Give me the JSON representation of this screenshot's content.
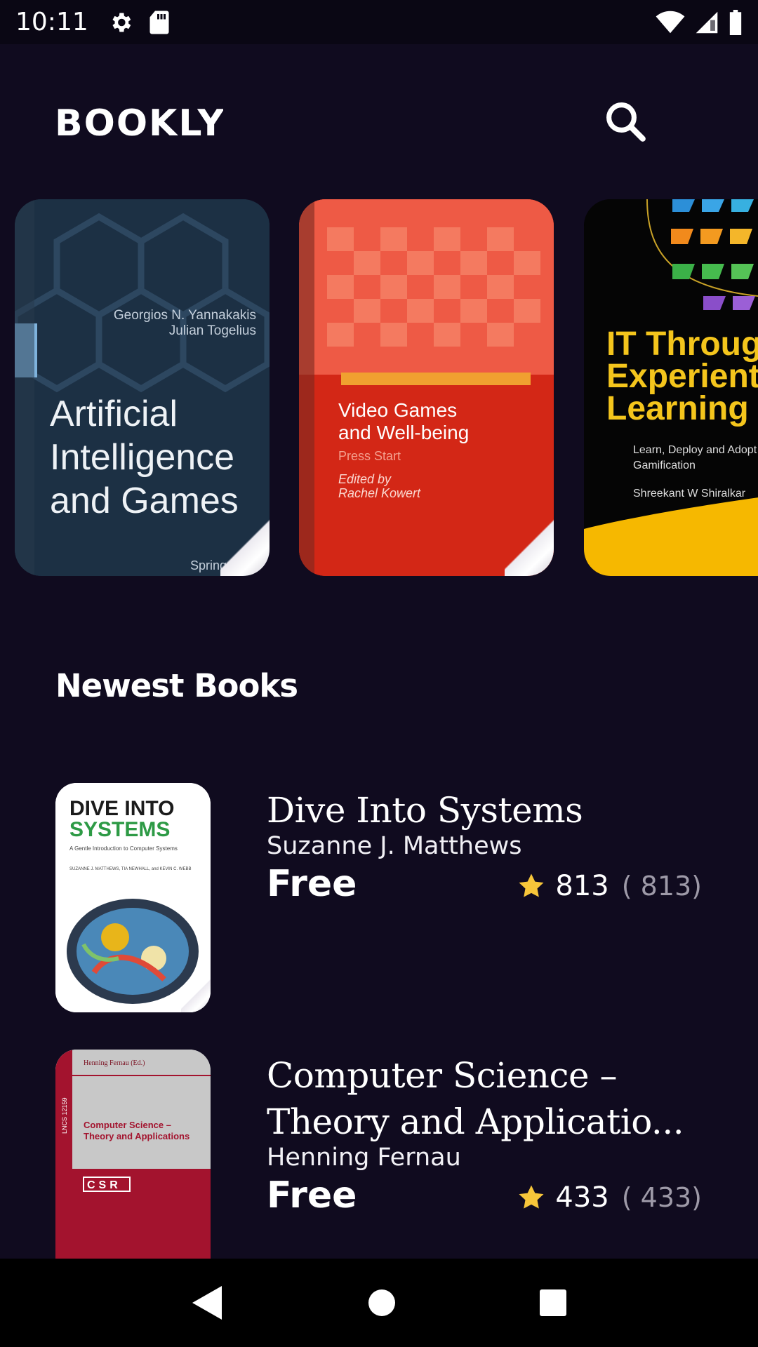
{
  "status_bar": {
    "time": "10:11"
  },
  "header": {
    "logo_text": "BOOKLY",
    "search_icon": "search-icon"
  },
  "carousel": [
    {
      "title_lines": [
        "Artificial",
        "Intelligence",
        "and Games"
      ],
      "authors": [
        "Georgios N. Yannakakis",
        "Julian Togelius"
      ],
      "publisher": "Springer",
      "color": "#1c3044"
    },
    {
      "title_lines": [
        "Video Games",
        "and Well-being"
      ],
      "subtitle": "Press Start",
      "editor_lines": [
        "Edited by",
        "Rachel Kowert"
      ],
      "color": "#d32716"
    },
    {
      "title_lines": [
        "IT Through",
        "Experientia",
        "Learning"
      ],
      "subtitle_lines": [
        "Learn, Deploy and Adopt",
        "Gamification"
      ],
      "author": "Shreekant W Shiralkar",
      "color": "#050505"
    }
  ],
  "section": {
    "title": "Newest Books"
  },
  "books": [
    {
      "title_lines": [
        "Dive Into Systems"
      ],
      "author": "Suzanne J. Matthews",
      "price": "Free",
      "rating": "813",
      "count": "( 813)",
      "cover": {
        "line1": "DIVE INTO",
        "line2": "SYSTEMS",
        "tagline": "A Gentle Introduction to Computer Systems",
        "authors": "SUZANNE J. MATTHEWS, TIA NEWHALL, and KEVIN C. WEBB"
      }
    },
    {
      "title_lines": [
        "Computer Science –",
        "Theory and Applicatio..."
      ],
      "author": "Henning Fernau",
      "price": "Free",
      "rating": "433",
      "count": "( 433)",
      "cover": {
        "editor": "Henning Fernau (Ed.)",
        "title_lines": [
          "Computer Science –",
          "Theory and Applications"
        ],
        "series": "LNCS 12159",
        "badge": "CSR"
      }
    }
  ],
  "colors": {
    "background": "#100b1f",
    "star": "#f7c63a",
    "muted": "#9e9aa8"
  },
  "nav": {
    "back_icon": "back-triangle-icon",
    "home_icon": "home-circle-icon",
    "recents_icon": "recents-square-icon"
  }
}
